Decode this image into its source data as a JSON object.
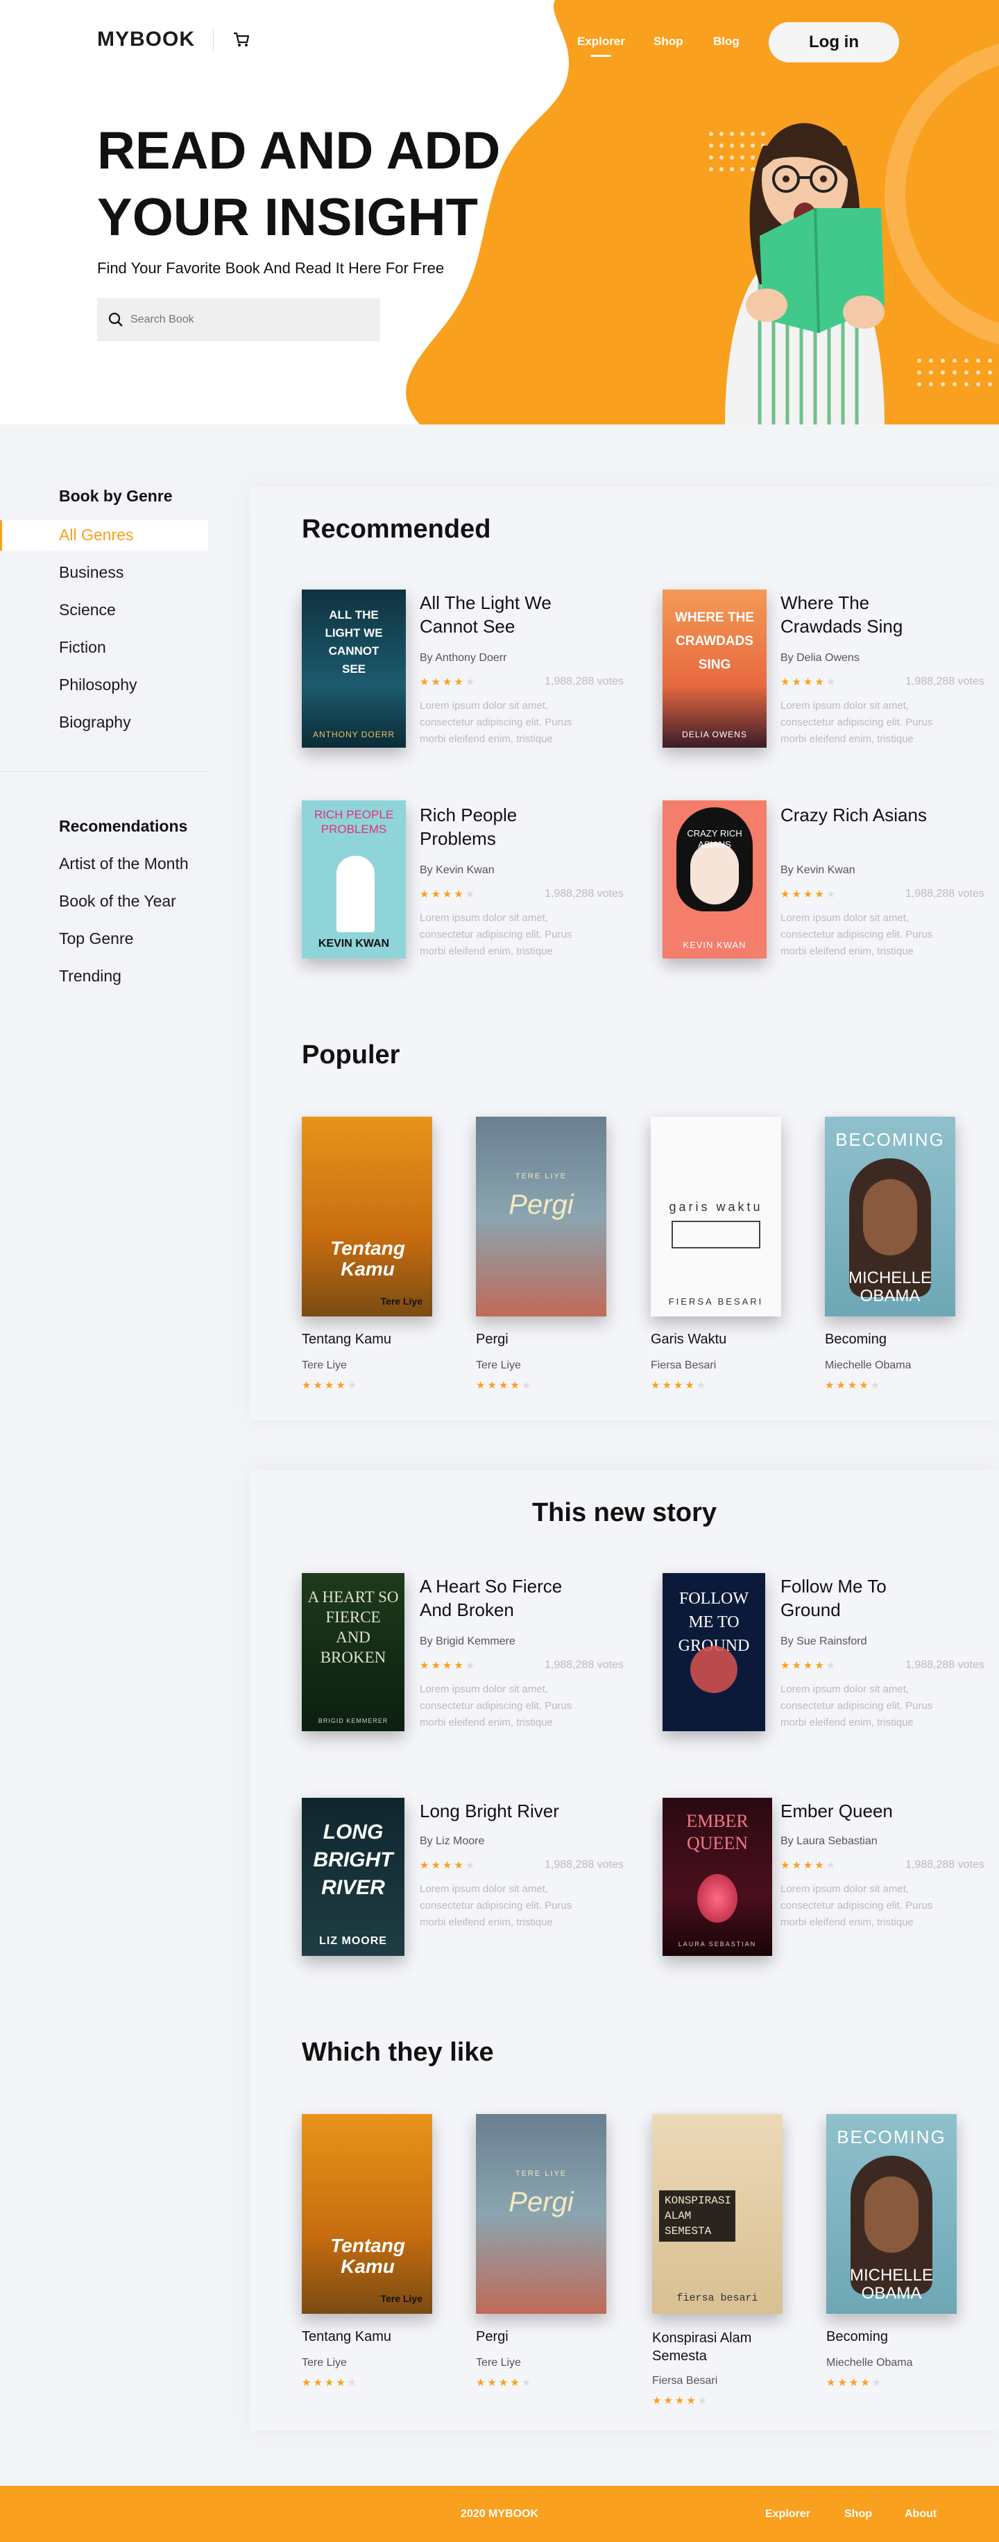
{
  "brand": {
    "logo": "MYBOOK"
  },
  "nav": {
    "items": [
      "Explorer",
      "Shop",
      "Blog"
    ],
    "login": "Log in"
  },
  "hero": {
    "title_line1": "READ AND ADD",
    "title_line2": "YOUR INSIGHT",
    "subtitle": "Find Your Favorite Book And Read It Here For Free",
    "search_placeholder": "Search Book"
  },
  "sidebar": {
    "genre_heading": "Book by Genre",
    "genres": [
      "All Genres",
      "Business",
      "Science",
      "Fiction",
      "Philosophy",
      "Biography"
    ],
    "rec_heading": "Recomendations",
    "recs": [
      "Artist of the Month",
      "Book of the Year",
      "Top Genre",
      "Trending"
    ]
  },
  "recommended": {
    "title": "Recommended",
    "books": [
      {
        "title": "All The Light We Cannot See",
        "author": "By Anthony Doerr",
        "votes": "1,988,288 votes",
        "desc": "Lorem ipsum dolor sit amet, consectetur adipiscing elit. Purus morbi eleifend enim, tristique",
        "rating": 4,
        "cover_text": "ALL THE LIGHT WE CANNOT SEE",
        "cover_author": "ANTHONY DOERR"
      },
      {
        "title": "Where The Crawdads Sing",
        "author": "By Delia Owens",
        "votes": "1,988,288 votes",
        "desc": "Lorem ipsum dolor sit amet, consectetur adipiscing elit. Purus morbi eleifend enim, tristique",
        "rating": 4,
        "cover_text": "WHERE THE CRAWDADS SING",
        "cover_author": "DELIA OWENS"
      },
      {
        "title": "Rich People Problems",
        "author": "By Kevin Kwan",
        "votes": "1,988,288 votes",
        "desc": "Lorem ipsum dolor sit amet, consectetur adipiscing elit. Purus morbi eleifend enim, tristique",
        "rating": 4,
        "cover_text": "RICH PEOPLE PROBLEMS",
        "cover_author": "KEVIN KWAN"
      },
      {
        "title": "Crazy Rich Asians",
        "author": "By Kevin Kwan",
        "votes": "1,988,288 votes",
        "desc": "Lorem ipsum dolor sit amet, consectetur adipiscing elit. Purus morbi eleifend enim, tristique",
        "rating": 4,
        "cover_text": "CRAZY RICH ASIANS",
        "cover_author": "KEVIN KWAN"
      }
    ]
  },
  "populer": {
    "title": "Populer",
    "books": [
      {
        "title": "Tentang Kamu",
        "author": "Tere Liye",
        "rating": 4,
        "cover_text": "Tentang Kamu",
        "cover_author": "Tere Liye"
      },
      {
        "title": "Pergi",
        "author": "Tere Liye",
        "rating": 4,
        "cover_text": "Pergi",
        "cover_author": "TERE LIYE"
      },
      {
        "title": "Garis Waktu",
        "author": "Fiersa Besari",
        "rating": 4,
        "cover_text": "garis waktu",
        "cover_author": "FIERSA BESARI"
      },
      {
        "title": "Becoming",
        "author": "Miechelle Obama",
        "rating": 4,
        "cover_text": "BECOMING",
        "cover_author": "MICHELLE OBAMA"
      }
    ]
  },
  "new_story": {
    "title": "This new story",
    "books": [
      {
        "title": "A Heart So Fierce And Broken",
        "author": "By Brigid Kemmere",
        "votes": "1,988,288 votes",
        "desc": "Lorem ipsum dolor sit amet, consectetur adipiscing elit. Purus morbi eleifend enim, tristique",
        "rating": 4,
        "cover_text": "A HEART SO FIERCE AND BROKEN",
        "cover_author": "BRIGID KEMMERER"
      },
      {
        "title": "Follow Me To Ground",
        "author": "By Sue Rainsford",
        "votes": "1,988,288 votes",
        "desc": "Lorem ipsum dolor sit amet, consectetur adipiscing elit. Purus morbi eleifend enim, tristique",
        "rating": 4,
        "cover_text": "FOLLOW ME TO GROUND",
        "cover_author": ""
      },
      {
        "title": "Long Bright River",
        "author": "By Liz Moore",
        "votes": "1,988,288 votes",
        "desc": "Lorem ipsum dolor sit amet, consectetur adipiscing elit. Purus morbi eleifend enim, tristique",
        "rating": 4,
        "cover_text": "LONG BRIGHT RIVER",
        "cover_author": "LIZ MOORE"
      },
      {
        "title": "Ember Queen",
        "author": "By Laura Sebastian",
        "votes": "1,988,288 votes",
        "desc": "Lorem ipsum dolor sit amet, consectetur adipiscing elit. Purus morbi eleifend enim, tristique",
        "rating": 4,
        "cover_text": "EMBER QUEEN",
        "cover_author": "LAURA SEBASTIAN"
      }
    ]
  },
  "they_like": {
    "title": "Which they like",
    "books": [
      {
        "title": "Tentang Kamu",
        "author": "Tere Liye",
        "rating": 4,
        "cover_text": "Tentang Kamu",
        "cover_author": "Tere Liye"
      },
      {
        "title": "Pergi",
        "author": "Tere Liye",
        "rating": 4,
        "cover_text": "Pergi",
        "cover_author": "TERE LIYE"
      },
      {
        "title": "Konspirasi Alam Semesta",
        "author": "Fiersa Besari",
        "rating": 4,
        "cover_text": "KONSPIRASI ALAM SEMESTA",
        "cover_author": "fiersa besari"
      },
      {
        "title": "Becoming",
        "author": "Miechelle Obama",
        "rating": 4,
        "cover_text": "BECOMING",
        "cover_author": "MICHELLE OBAMA"
      }
    ]
  },
  "footer": {
    "copyright": "2020 MYBOOK",
    "links": [
      "Explorer",
      "Shop",
      "About"
    ]
  },
  "colors": {
    "accent": "#f9a01e",
    "background": "#f3f4f7"
  }
}
